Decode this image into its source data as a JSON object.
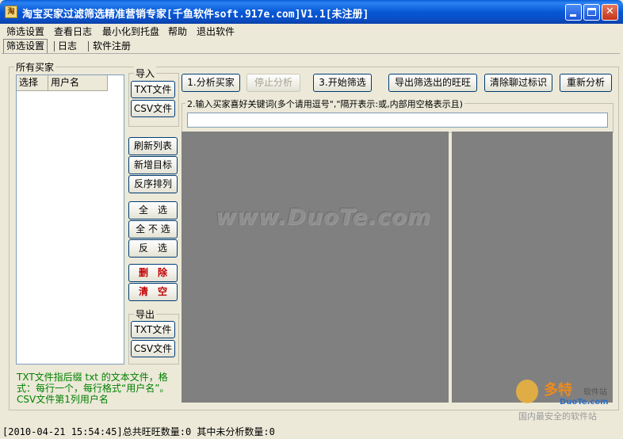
{
  "window": {
    "title": "淘宝买家过滤筛选精准营销专家[千鱼软件soft.917e.com]V1.1[未注册]",
    "icon_label": "淘"
  },
  "menu": [
    "筛选设置",
    "查看日志",
    "最小化到托盘",
    "帮助",
    "退出软件"
  ],
  "tabs": [
    "筛选设置",
    "日志",
    "软件注册"
  ],
  "buyers_group": {
    "label": "所有买家",
    "columns": [
      "选择",
      "用户名"
    ]
  },
  "import_group": {
    "label": "导入",
    "txt": "TXT文件",
    "csv": "CSV文件"
  },
  "list_actions": {
    "refresh": "刷新列表",
    "add_target": "新增目标",
    "reverse": "反序排列"
  },
  "select_actions": {
    "select_all": "全　选",
    "select_none": "全 不 选",
    "invert": "反　选"
  },
  "delete_actions": {
    "delete": "删　除",
    "clear": "清　空"
  },
  "export_group": {
    "label": "导出",
    "txt": "TXT文件",
    "csv": "CSV文件"
  },
  "hint_text": "TXT文件指后缀 txt 的文本文件，格式：每行一个，每行格式“用户名”。CSV文件第1列用户名",
  "toolbar": {
    "analyze": "1.分析买家",
    "stop": "停止分析",
    "start_filter": "3.开始筛选",
    "export": "导出筛选出的旺旺",
    "clear_mark": "清除聊过标识",
    "reanalyze": "重新分析"
  },
  "keyword": {
    "label": "2.输入买家喜好关键词(多个请用逗号\",\"隔开表示:或,内部用空格表示且)",
    "value": ""
  },
  "watermark": "www.DuoTe.com",
  "logo": {
    "main": "多特",
    "sub": "软件站",
    "url": "DuoTe.com",
    "slogan": "国内最安全的软件站"
  },
  "status": "[2010-04-21 15:54:45]总共旺旺数量:0 其中未分析数量:0",
  "colors": {
    "titlebar": "#0a5fd8",
    "panel": "#808080",
    "hint": "#008000",
    "danger": "#c00000"
  }
}
